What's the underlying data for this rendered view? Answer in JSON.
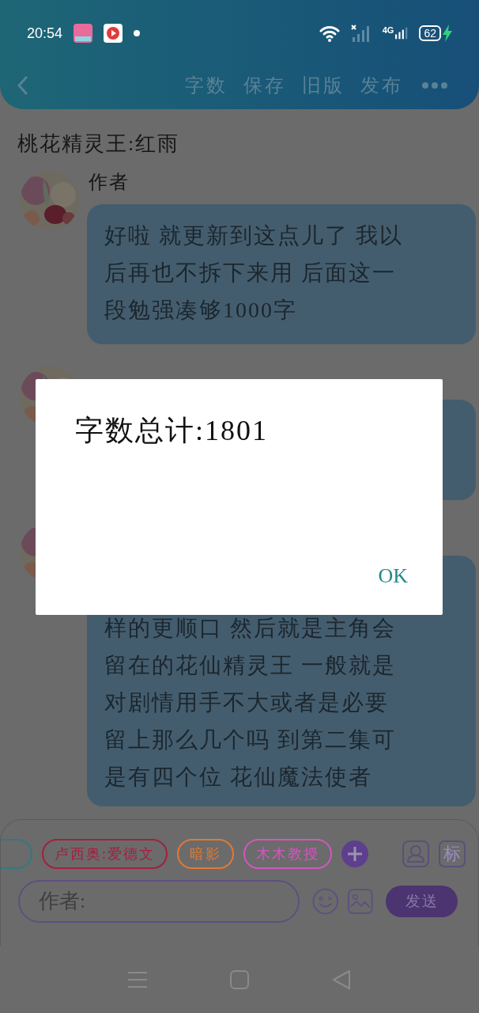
{
  "status_bar": {
    "time": "20:54",
    "network": "4G",
    "battery": "62"
  },
  "header": {
    "actions": [
      "字数",
      "保存",
      "旧版",
      "发布"
    ]
  },
  "title": "桃花精灵王:红雨",
  "messages": [
    {
      "kind": "text",
      "author": "作者",
      "lines": [
        "好啦 就更新到这点儿了 我以",
        "后再也不拆下来用 后面这一",
        "段勉强凑够1000字"
      ]
    },
    {
      "kind": "text"
    },
    {
      "kind": "text",
      "lines": [
        "样的更顺口 然后就是主角会",
        "留在的花仙精灵王 一般就是",
        "对剧情用手不大或者是必要",
        "留上那么几个吗 到第二集可",
        "是有四个位 花仙魔法使者"
      ]
    }
  ],
  "dialog": {
    "message": "字数总计:1801",
    "button": "OK"
  },
  "chips": [
    {
      "color": "#2f7a80"
    },
    {
      "label": "卢西奥:爱德文",
      "color": "#a3203f"
    },
    {
      "label": "暗影",
      "color": "#e07a34"
    },
    {
      "label": "木木教授",
      "color": "#d256c2"
    }
  ],
  "tag_button": "标",
  "input": {
    "placeholder": "作者:"
  },
  "send_button": "发送"
}
